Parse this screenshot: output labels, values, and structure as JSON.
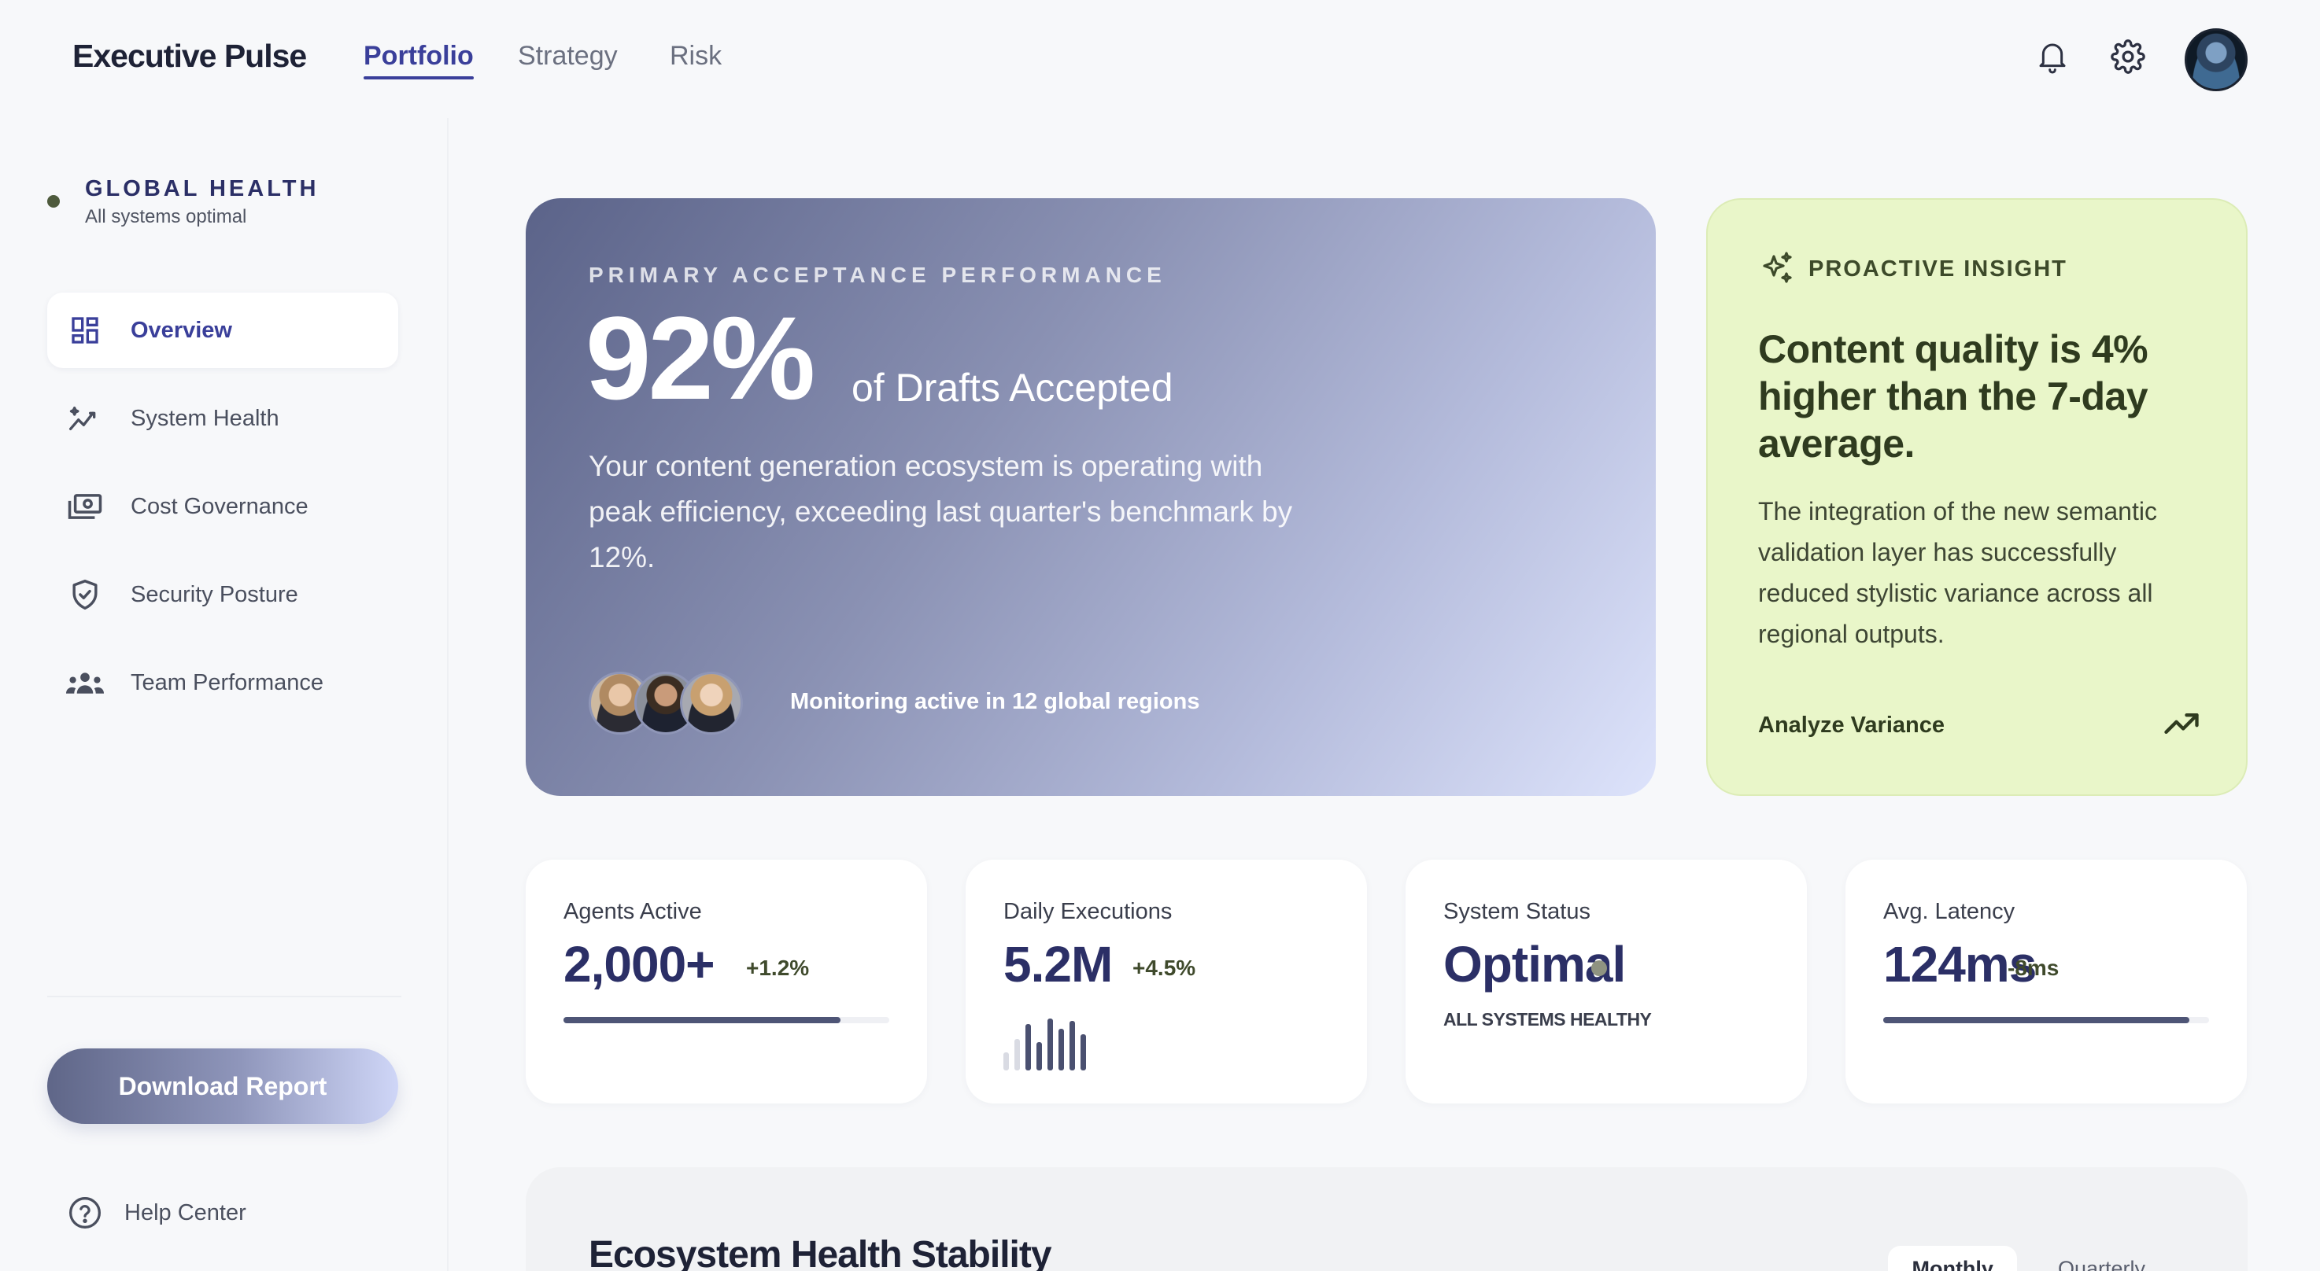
{
  "header": {
    "brand": "Executive Pulse",
    "tabs": [
      {
        "label": "Portfolio",
        "active": true
      },
      {
        "label": "Strategy",
        "active": false
      },
      {
        "label": "Risk",
        "active": false
      }
    ],
    "icons": [
      "bell-icon",
      "gear-icon"
    ]
  },
  "sidebar": {
    "health_title": "GLOBAL HEALTH",
    "health_sub": "All systems optimal",
    "items": [
      {
        "label": "Overview",
        "icon": "dashboard-icon",
        "active": true
      },
      {
        "label": "System Health",
        "icon": "health-pulse-icon",
        "active": false
      },
      {
        "label": "Cost Governance",
        "icon": "money-icon",
        "active": false
      },
      {
        "label": "Security Posture",
        "icon": "shield-icon",
        "active": false
      },
      {
        "label": "Team Performance",
        "icon": "team-icon",
        "active": false
      }
    ],
    "download_label": "Download Report",
    "help_label": "Help Center"
  },
  "hero": {
    "kicker": "PRIMARY ACCEPTANCE PERFORMANCE",
    "value": "92%",
    "value_sub": "of Drafts Accepted",
    "description": "Your content generation ecosystem is operating with peak efficiency, exceeding last quarter's benchmark by 12%.",
    "monitoring": "Monitoring active in 12 global regions"
  },
  "insight": {
    "kicker": "PROACTIVE INSIGHT",
    "title": "Content quality is 4% higher than the 7-day average.",
    "body": "The integration of the new semantic validation layer has successfully reduced stylistic variance across all regional outputs.",
    "action": "Analyze Variance"
  },
  "stats": {
    "agents": {
      "label": "Agents Active",
      "value": "2,000+",
      "delta": "+1.2%",
      "progress": 0.85
    },
    "executions": {
      "label": "Daily Executions",
      "value": "5.2M",
      "delta": "+4.5%",
      "bars": [
        0.35,
        0.6,
        0.9,
        0.55,
        1.0,
        0.8,
        0.95,
        0.7
      ]
    },
    "status": {
      "label": "System Status",
      "value": "Optimal",
      "caption": "ALL SYSTEMS HEALTHY"
    },
    "latency": {
      "label": "Avg. Latency",
      "value": "124ms",
      "delta": "-8ms",
      "progress": 0.94
    }
  },
  "stability": {
    "title": "Ecosystem Health Stability",
    "tabs": [
      {
        "label": "Monthly",
        "active": true
      },
      {
        "label": "Quarterly",
        "active": false
      }
    ]
  },
  "colors": {
    "accent": "#3a3f9a",
    "insight_bg": "#e9f6c9",
    "hero_start": "#5b6389",
    "hero_end": "#dde3fb"
  }
}
